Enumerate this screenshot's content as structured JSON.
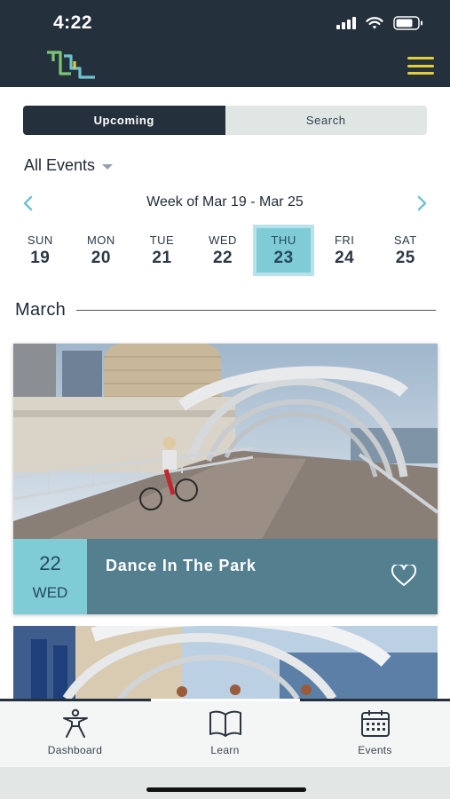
{
  "status_bar": {
    "time": "4:22"
  },
  "header": {
    "logo_icon": "tl-logo-icon",
    "menu_icon": "hamburger-menu-icon"
  },
  "segment": {
    "upcoming": "Upcoming",
    "search": "Search",
    "active": "Upcoming"
  },
  "filter": {
    "label": "All Events"
  },
  "week": {
    "label": "Week of Mar 19 - Mar 25",
    "prev_icon": "chevron-left-icon",
    "next_icon": "chevron-right-icon"
  },
  "days": [
    {
      "name": "SUN",
      "date": "19"
    },
    {
      "name": "MON",
      "date": "20"
    },
    {
      "name": "TUE",
      "date": "21"
    },
    {
      "name": "WED",
      "date": "22"
    },
    {
      "name": "THU",
      "date": "23"
    },
    {
      "name": "FRI",
      "date": "24"
    },
    {
      "name": "SAT",
      "date": "25"
    }
  ],
  "selected_day": "23",
  "month": {
    "label": "March"
  },
  "events": [
    {
      "day_num": "22",
      "day_name": "WED",
      "title": "Dance In The Park",
      "favorite_icon": "heart-outline-icon"
    }
  ],
  "tabbar": {
    "items": [
      {
        "label": "Dashboard",
        "icon": "person-figure-icon"
      },
      {
        "label": "Learn",
        "icon": "open-book-icon"
      },
      {
        "label": "Events",
        "icon": "calendar-icon"
      }
    ]
  },
  "colors": {
    "navy": "#25303d",
    "teal_light": "#7fcbd6",
    "teal_dark": "#537f8f",
    "accent_yellow": "#e3cf3a"
  }
}
